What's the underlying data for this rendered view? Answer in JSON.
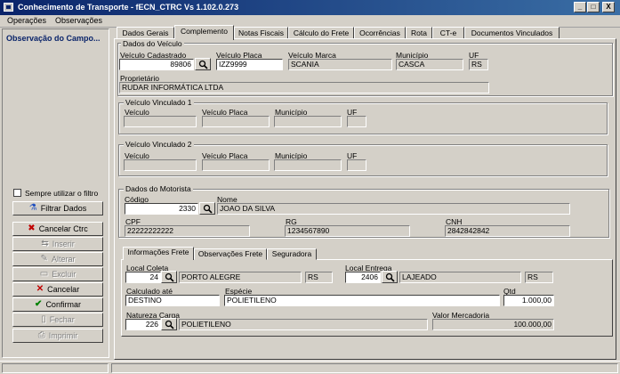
{
  "window": {
    "title": "Conhecimento de Transporte - fECN_CTRC Vs 1.102.0.273",
    "controls": {
      "minimize": "_",
      "maximize": "□",
      "close": "X"
    }
  },
  "menu": [
    "Operações",
    "Observações"
  ],
  "left_panel": {
    "header": "Observação do Campo...",
    "always_use_filter_label": "Sempre utilizar o filtro",
    "filter_button": "Filtrar Dados",
    "buttons": {
      "cancel_ctrc": "Cancelar Ctrc",
      "insert": "Inserir",
      "edit": "Alterar",
      "delete": "Excluir",
      "cancel": "Cancelar",
      "confirm": "Confirmar",
      "close": "Fechar",
      "print": "Imprimir"
    }
  },
  "tabs": [
    "Dados Gerais",
    "Complemento",
    "Notas Fiscais",
    "Cálculo do Frete",
    "Ocorrências",
    "Rota",
    "CT-e",
    "Documentos Vinculados"
  ],
  "active_tab": "Complemento",
  "vehicle": {
    "group_title": "Dados do Veículo",
    "labels": {
      "registered": "Veículo Cadastrado",
      "plate": "Veículo Placa",
      "brand": "Veículo Marca",
      "city": "Município",
      "uf": "UF",
      "owner": "Proprietário"
    },
    "registered": "89806",
    "plate": "IZZ9999",
    "brand": "SCANIA",
    "city": "CASCA",
    "uf": "RS",
    "owner": "RUDAR INFORMÁTICA LTDA"
  },
  "linked_vehicle_1": {
    "group_title": "Veículo Vinculado 1",
    "labels": {
      "vehicle": "Veículo",
      "plate": "Veículo Placa",
      "city": "Município",
      "uf": "UF"
    }
  },
  "linked_vehicle_2": {
    "group_title": "Veículo Vinculado 2",
    "labels": {
      "vehicle": "Veículo",
      "plate": "Veículo Placa",
      "city": "Município",
      "uf": "UF"
    }
  },
  "driver": {
    "group_title": "Dados do Motorista",
    "labels": {
      "code": "Código",
      "name": "Nome",
      "cpf": "CPF",
      "rg": "RG",
      "cnh": "CNH"
    },
    "code": "2330",
    "name": "JOAO DA SILVA",
    "cpf": "22222222222",
    "rg": "1234567890",
    "cnh": "2842842842"
  },
  "inner_tabs": [
    "Informações Frete",
    "Observações Frete",
    "Seguradora"
  ],
  "active_inner_tab": "Informações Frete",
  "freight": {
    "labels": {
      "collection": "Local Coleta",
      "delivery": "Local Entrega",
      "calculated_until": "Calculado até",
      "species": "Espécie",
      "qty": "Qtd",
      "cargo_nature": "Natureza Carga",
      "merchandise_value": "Valor Mercadoria"
    },
    "collection_code": "24",
    "collection_city": "PORTO ALEGRE",
    "collection_uf": "RS",
    "delivery_code": "2406",
    "delivery_city": "LAJEADO",
    "delivery_uf": "RS",
    "calculated_until": "DESTINO",
    "species": "POLIETILENO",
    "qty": "1.000,00",
    "cargo_nature_code": "226",
    "cargo_nature": "POLIETILENO",
    "merchandise_value": "100.000,00"
  }
}
